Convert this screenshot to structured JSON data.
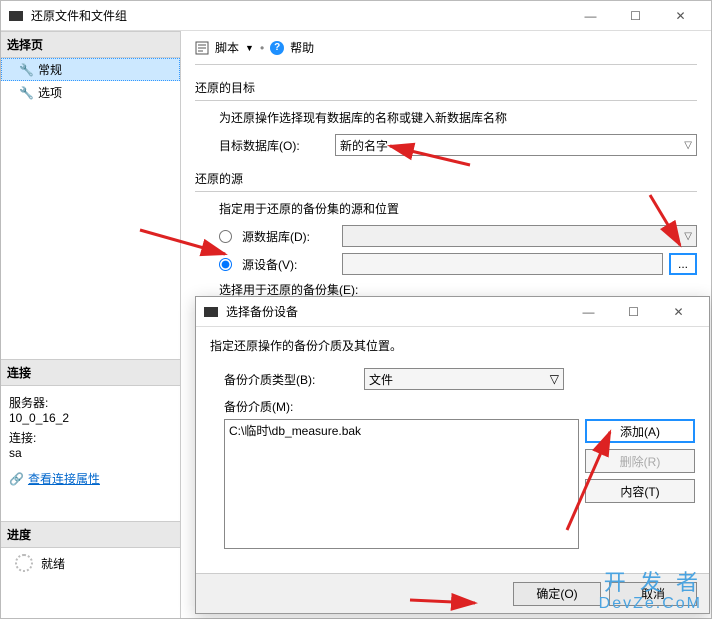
{
  "main_window": {
    "title": "还原文件和文件组",
    "sidebar": {
      "select_header": "选择页",
      "items": [
        {
          "icon": "wrench",
          "label": "常规",
          "selected": true
        },
        {
          "icon": "wrench",
          "label": "选项",
          "selected": false
        }
      ],
      "conn_header": "连接",
      "server_label": "服务器:",
      "server_value": "10_0_16_2",
      "connection_label": "连接:",
      "connection_value": "sa",
      "view_conn_props": "查看连接属性",
      "progress_header": "进度",
      "progress_status": "就绪"
    },
    "toolbar": {
      "script_label": "脚本",
      "help_label": "帮助"
    },
    "dest": {
      "group": "还原的目标",
      "desc": "为还原操作选择现有数据库的名称或键入新数据库名称",
      "db_label": "目标数据库(O):",
      "db_value": "新的名字"
    },
    "source": {
      "group": "还原的源",
      "desc": "指定用于还原的备份集的源和位置",
      "radio_db": "源数据库(D):",
      "radio_device": "源设备(V):",
      "device_value": "",
      "browse": "...",
      "sets_label": "选择用于还原的备份集(E):"
    }
  },
  "modal": {
    "title": "选择备份设备",
    "desc": "指定还原操作的备份介质及其位置。",
    "media_type_label": "备份介质类型(B):",
    "media_type_value": "文件",
    "media_label": "备份介质(M):",
    "media_items": [
      "C:\\临时\\db_measure.bak"
    ],
    "buttons": {
      "add": "添加(A)",
      "remove": "删除(R)",
      "contents": "内容(T)"
    },
    "footer": {
      "ok": "确定(O)",
      "cancel": "取消"
    }
  },
  "winctrl": {
    "min": "—",
    "max": "☐",
    "close": "✕"
  },
  "watermark": {
    "line1": "开 发 者",
    "line2": "DevZe.CoM"
  }
}
